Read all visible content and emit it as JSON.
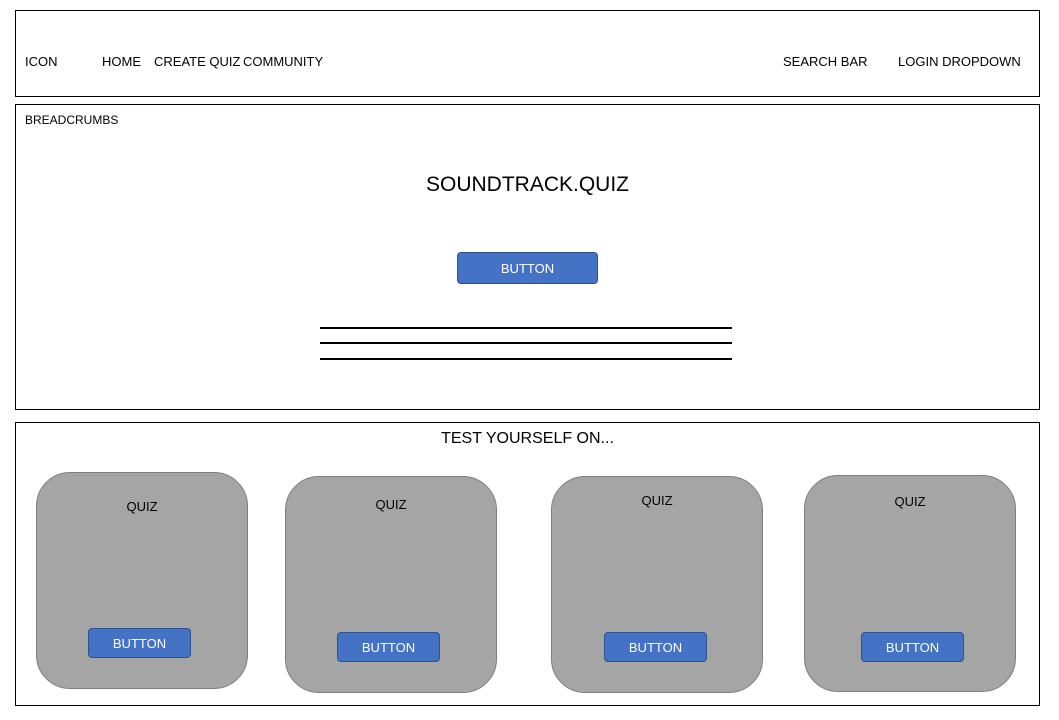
{
  "nav": {
    "icon": "ICON",
    "home": "HOME",
    "create_quiz": "CREATE QUIZ",
    "community": "COMMUNITY",
    "search": "SEARCH BAR",
    "login": "LOGIN DROPDOWN"
  },
  "hero": {
    "breadcrumbs": "BREADCRUMBS",
    "title": "SOUNDTRACK.QUIZ",
    "button": "BUTTON"
  },
  "quizzes": {
    "title": "TEST YOURSELF ON...",
    "cards": [
      {
        "label": "QUIZ",
        "button": "BUTTON"
      },
      {
        "label": "QUIZ",
        "button": "BUTTON"
      },
      {
        "label": "QUIZ",
        "button": "BUTTON"
      },
      {
        "label": "QUIZ",
        "button": "BUTTON"
      }
    ]
  },
  "colors": {
    "button": "#4472c4",
    "card": "#a5a5a5"
  }
}
